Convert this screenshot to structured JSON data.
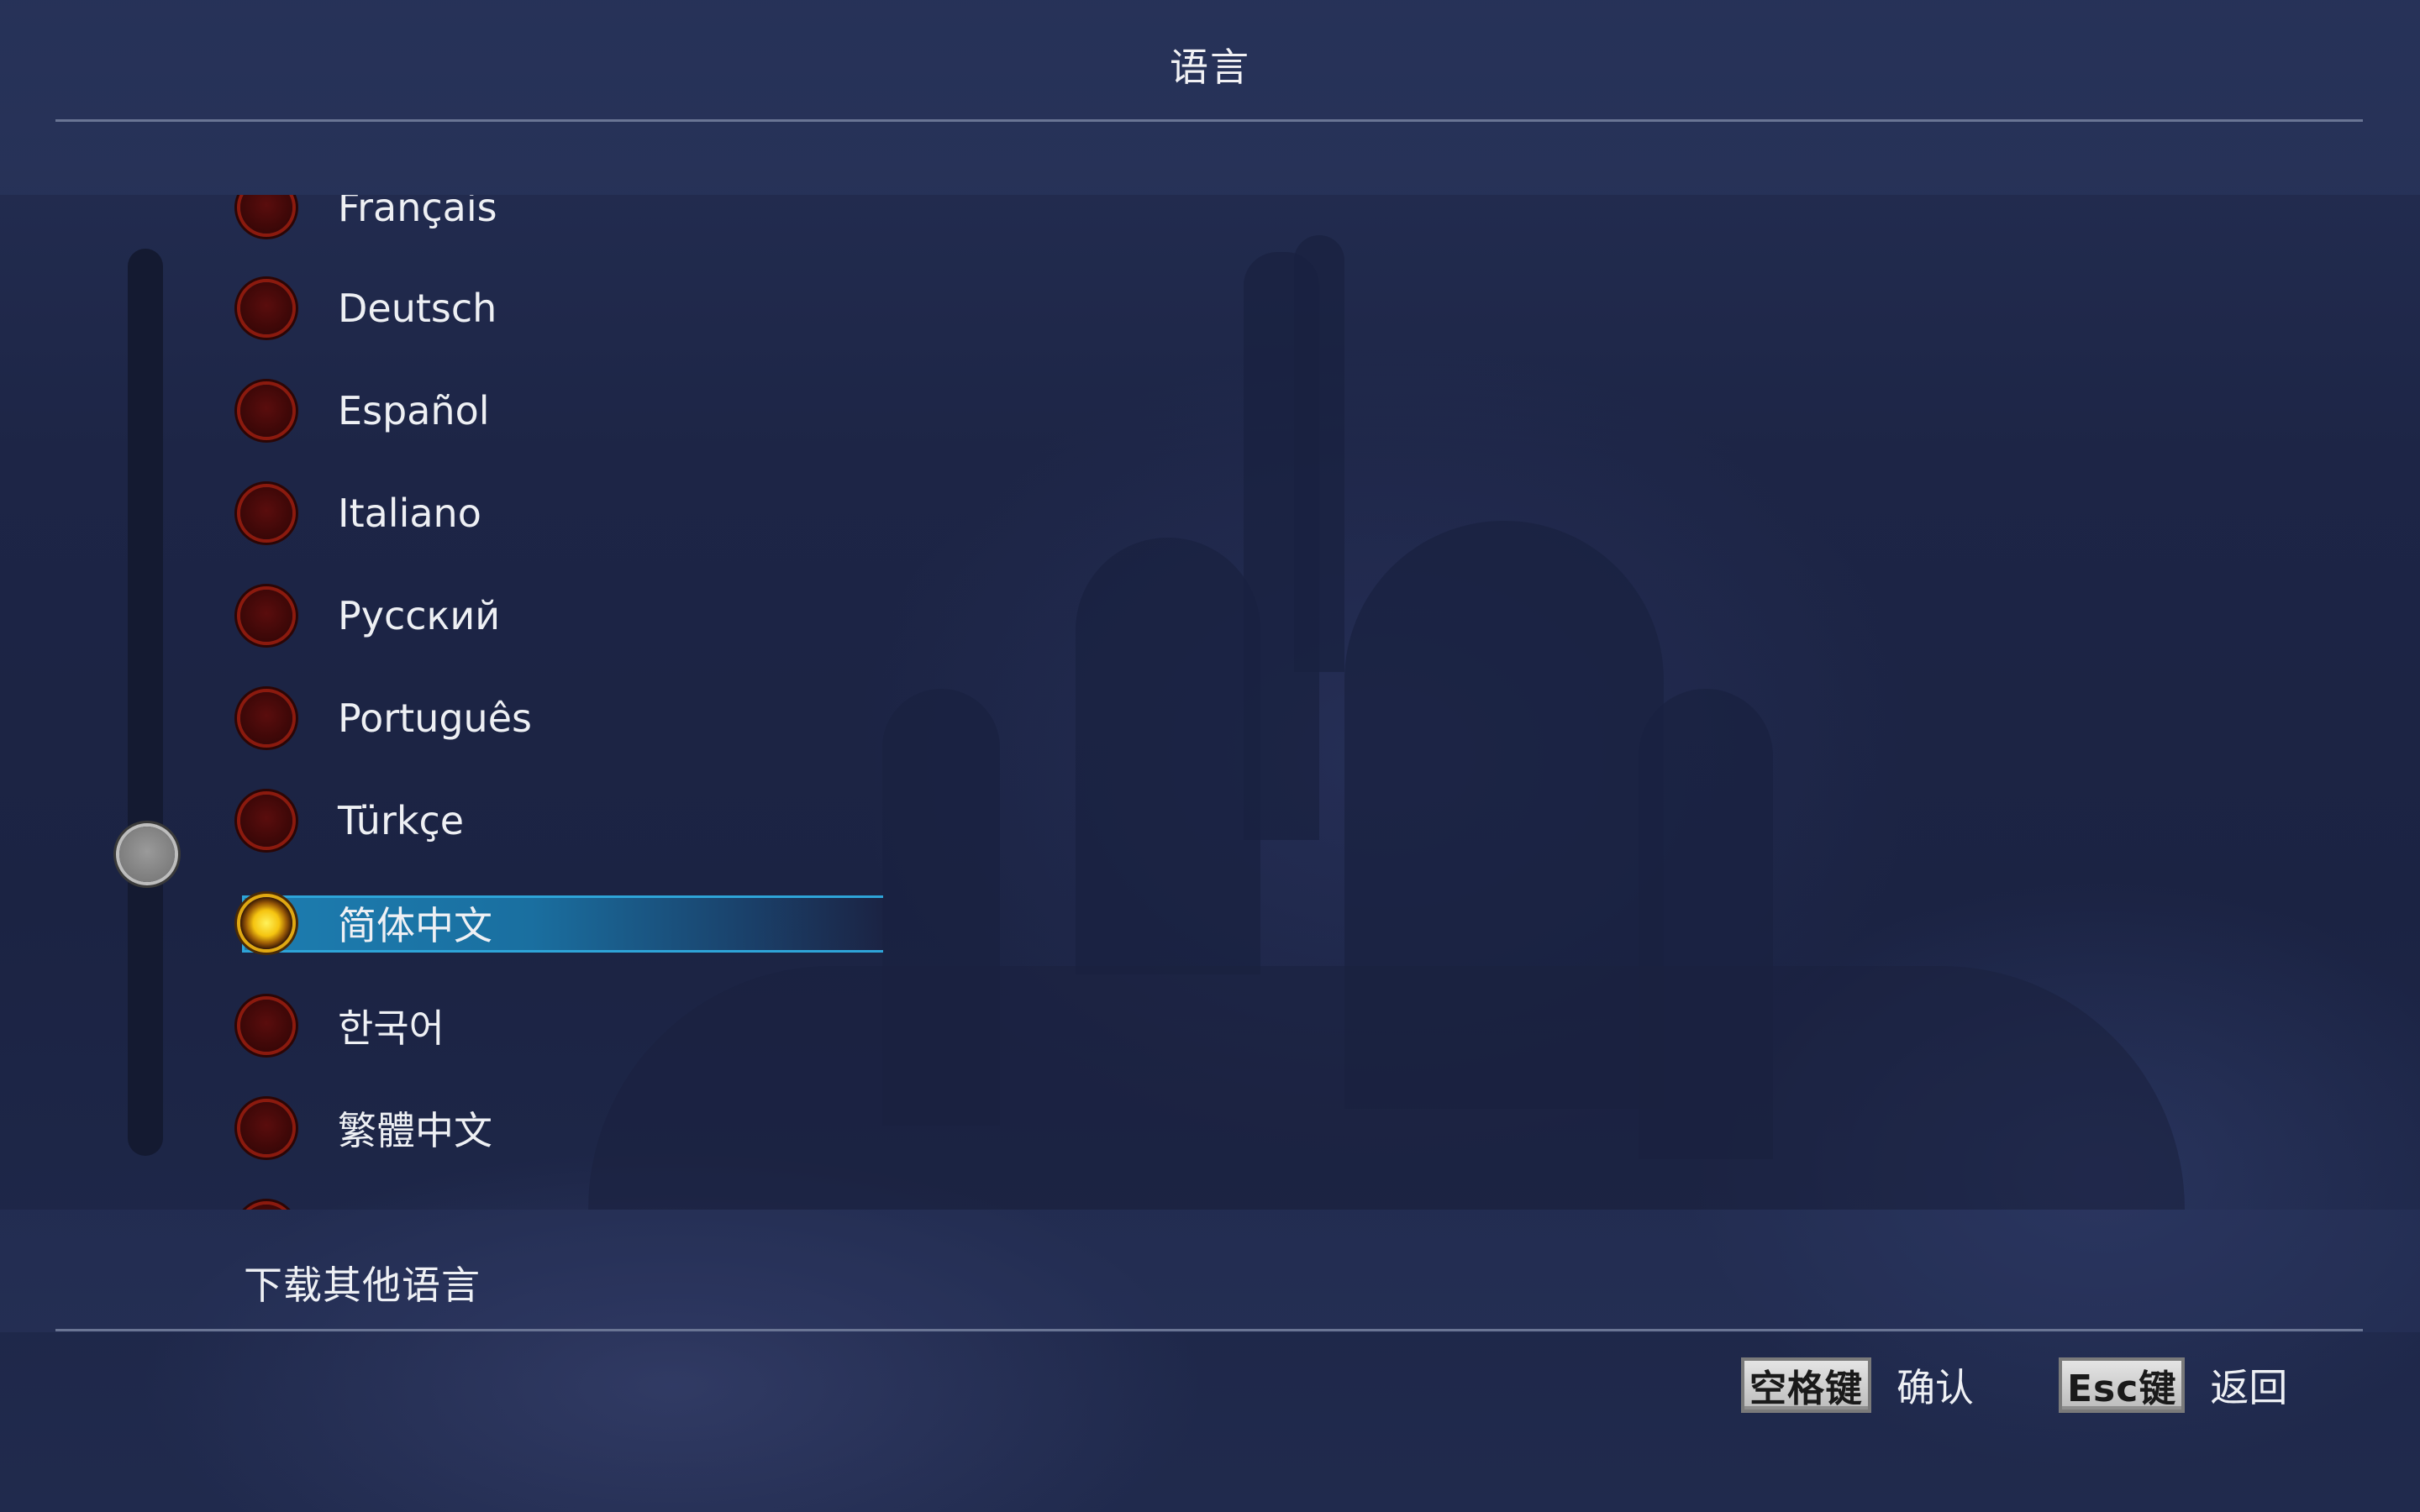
{
  "header": {
    "title": "语言"
  },
  "languages": [
    {
      "label": "Français",
      "selected": false
    },
    {
      "label": "Deutsch",
      "selected": false
    },
    {
      "label": "Español",
      "selected": false
    },
    {
      "label": "Italiano",
      "selected": false
    },
    {
      "label": "Русский",
      "selected": false
    },
    {
      "label": "Português",
      "selected": false
    },
    {
      "label": "Türkçe",
      "selected": false
    },
    {
      "label": "简体中文",
      "selected": true
    },
    {
      "label": "한국어",
      "selected": false
    },
    {
      "label": "繁體中文",
      "selected": false
    },
    {
      "label": "",
      "selected": false
    }
  ],
  "download_other": "下载其他语言",
  "footer": {
    "confirm_key": "空格键",
    "confirm_label": "确认",
    "back_key": "Esc键",
    "back_label": "返回"
  },
  "colors": {
    "selected_highlight": "#1d7db0",
    "radio_off": "#5a0d0d",
    "radio_on": "#f5c410",
    "background": "#1d2546"
  }
}
